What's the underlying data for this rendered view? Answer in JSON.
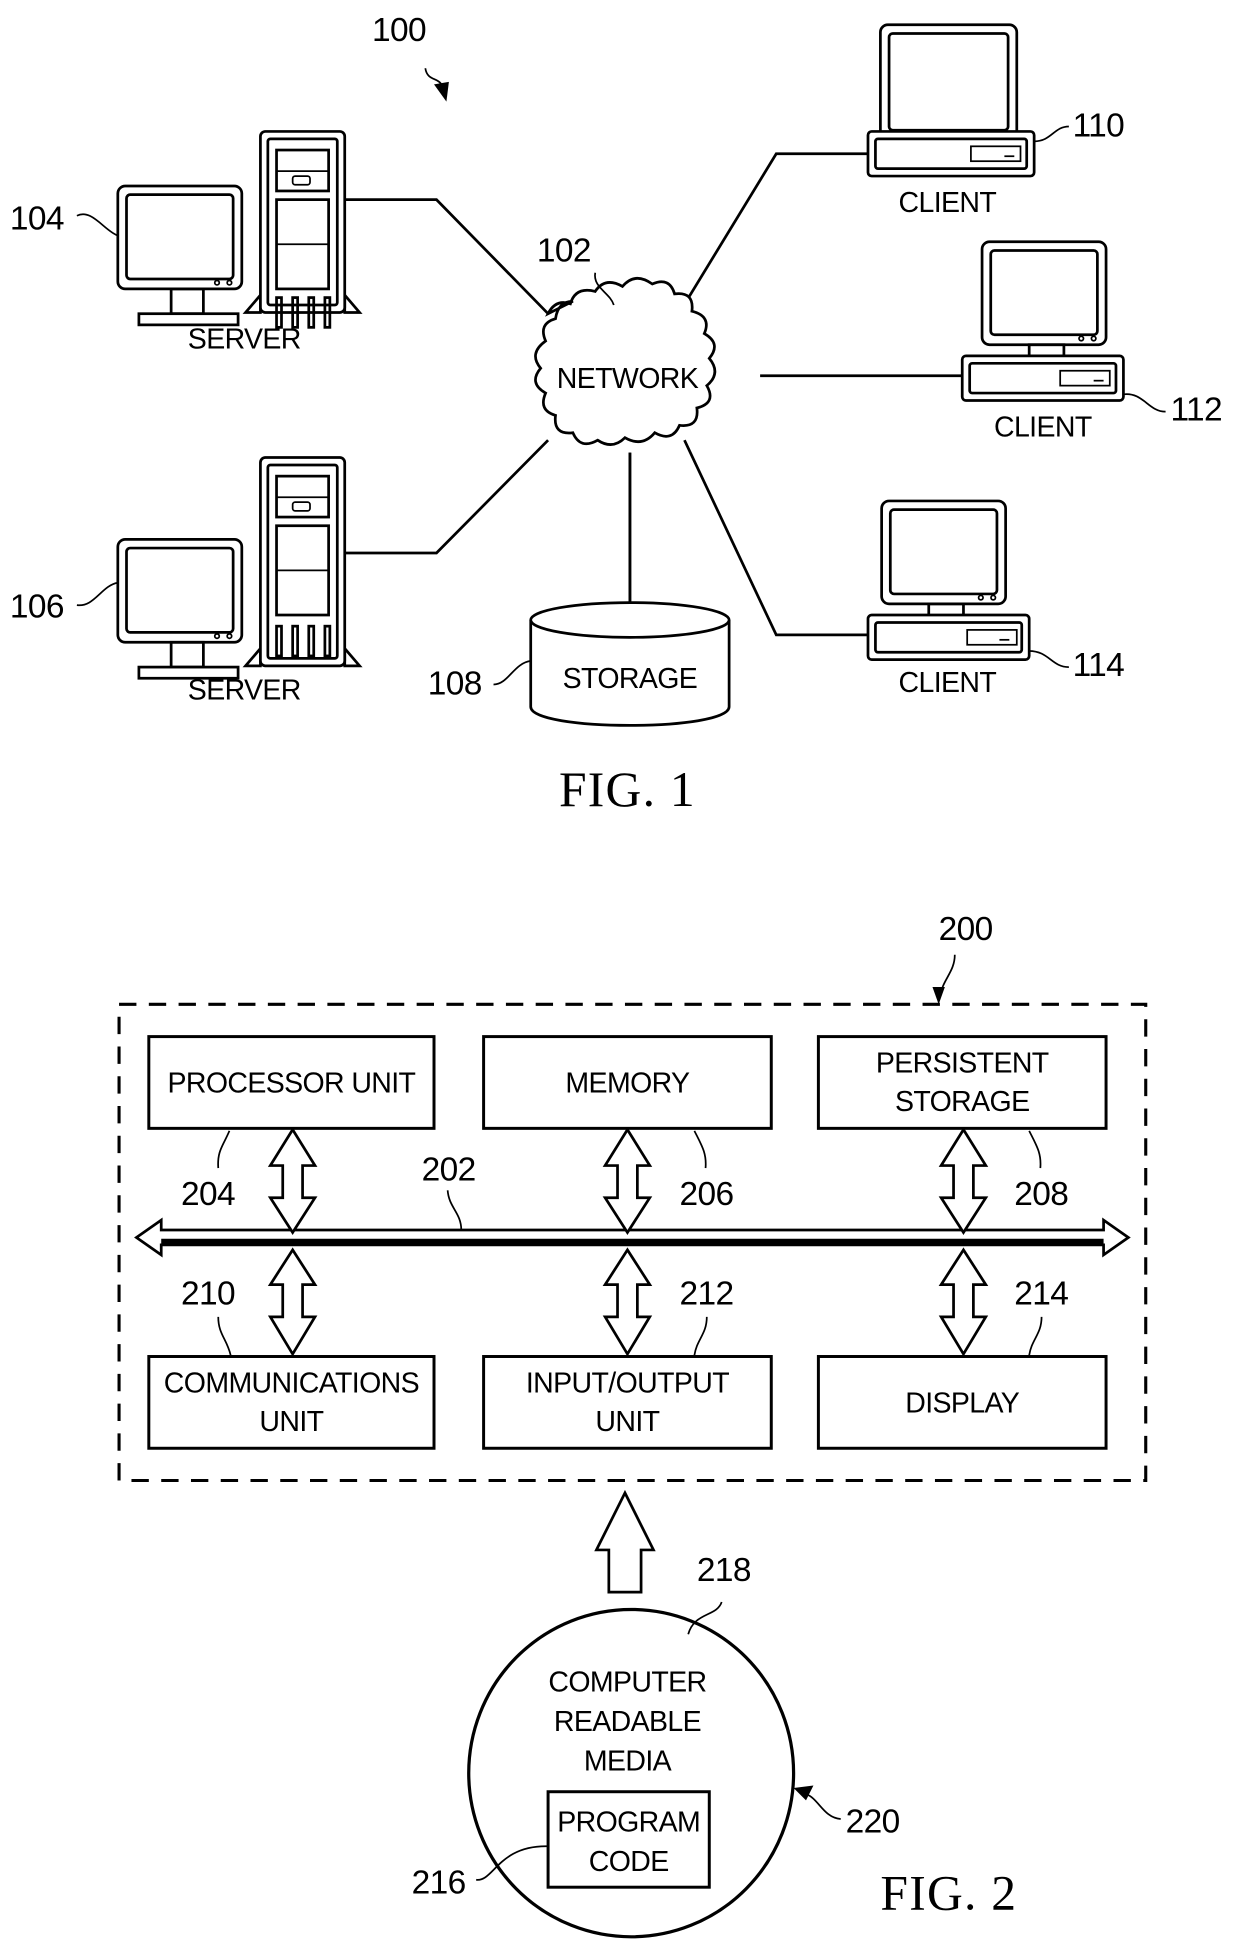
{
  "figure1": {
    "caption": "FIG. 1",
    "system_ref": "100",
    "network": {
      "label": "NETWORK",
      "ref": "102"
    },
    "servers": [
      {
        "label": "SERVER",
        "ref": "104"
      },
      {
        "label": "SERVER",
        "ref": "106"
      }
    ],
    "storage": {
      "label": "STORAGE",
      "ref": "108"
    },
    "clients": [
      {
        "label": "CLIENT",
        "ref": "110"
      },
      {
        "label": "CLIENT",
        "ref": "112"
      },
      {
        "label": "CLIENT",
        "ref": "114"
      }
    ]
  },
  "figure2": {
    "caption": "FIG. 2",
    "system_ref": "200",
    "bus_ref": "202",
    "top_units": [
      {
        "lines": [
          "PROCESSOR UNIT"
        ],
        "ref": "204"
      },
      {
        "lines": [
          "MEMORY"
        ],
        "ref": "206"
      },
      {
        "lines": [
          "PERSISTENT",
          "STORAGE"
        ],
        "ref": "208"
      }
    ],
    "bottom_units": [
      {
        "lines": [
          "COMMUNICATIONS",
          "UNIT"
        ],
        "ref": "210"
      },
      {
        "lines": [
          "INPUT/OUTPUT",
          "UNIT"
        ],
        "ref": "212"
      },
      {
        "lines": [
          "DISPLAY"
        ],
        "ref": "214"
      }
    ],
    "media": {
      "lines": [
        "COMPUTER",
        "READABLE",
        "MEDIA"
      ],
      "ref": "218",
      "product_ref": "220",
      "program_code": {
        "lines": [
          "PROGRAM",
          "CODE"
        ],
        "ref": "216"
      }
    }
  }
}
